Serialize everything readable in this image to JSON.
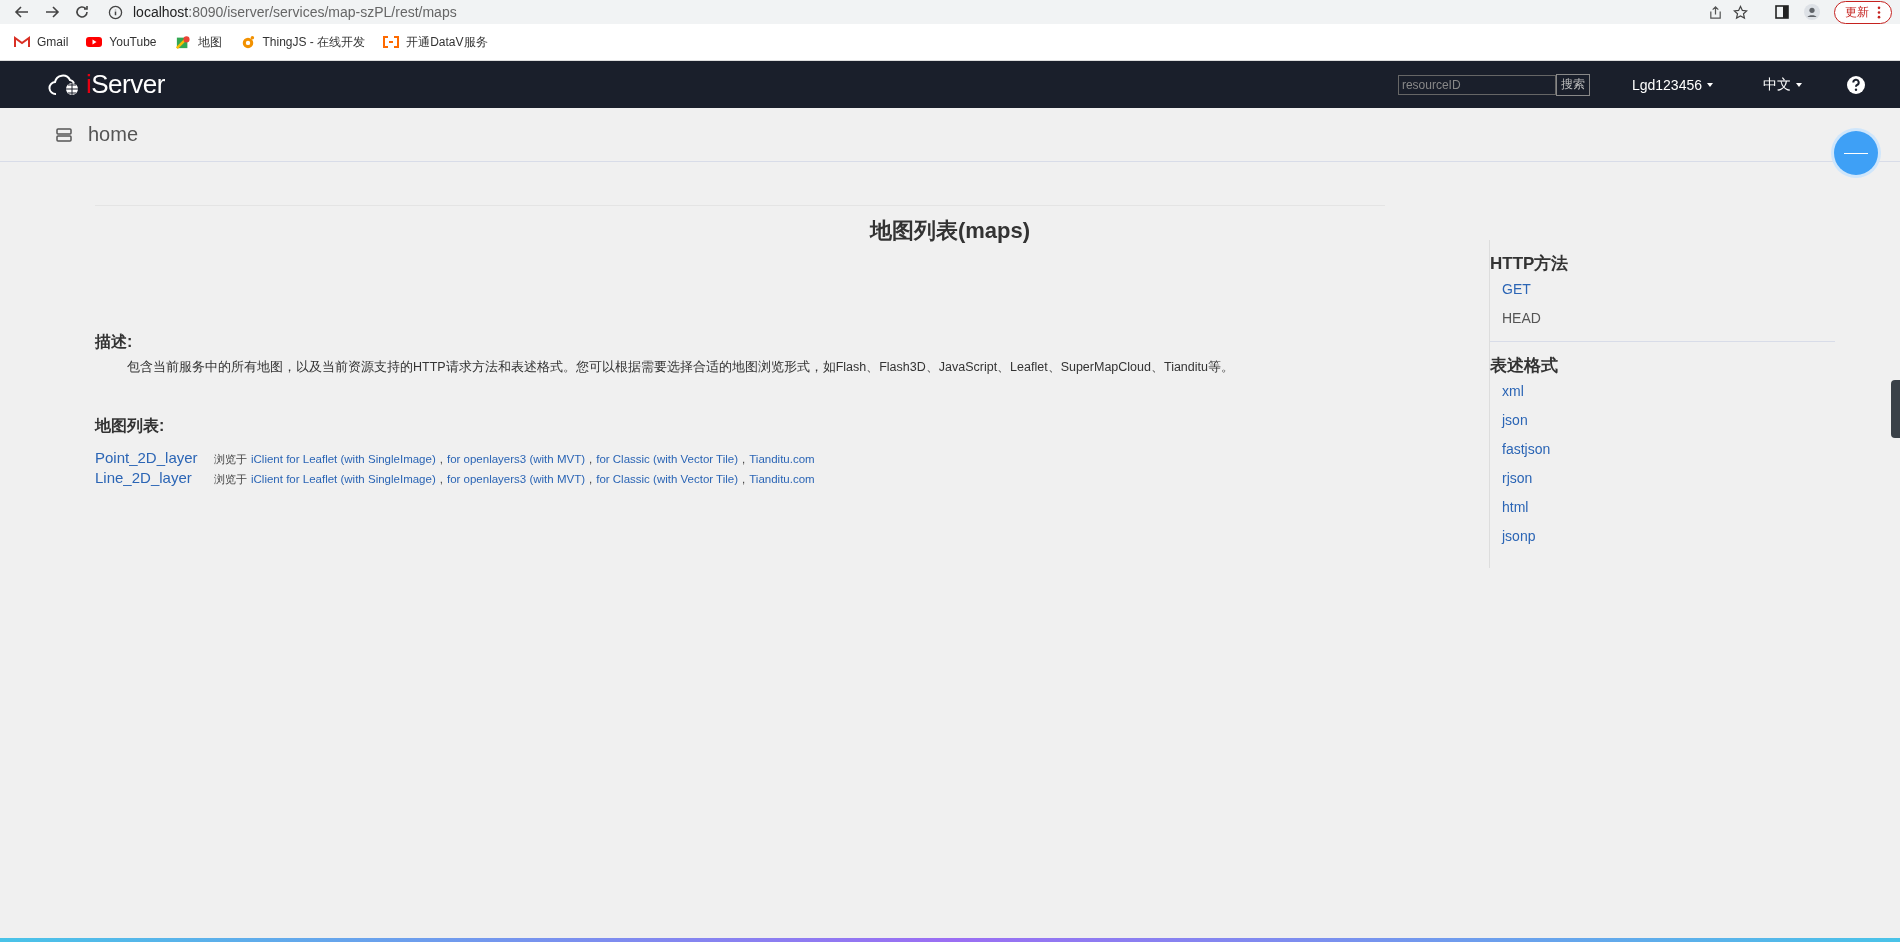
{
  "browser": {
    "url_host": "localhost",
    "url_rest": ":8090/iserver/services/map-szPL/rest/maps",
    "update_button": "更新",
    "bookmarks": [
      {
        "label": "Gmail",
        "kind": "gmail"
      },
      {
        "label": "YouTube",
        "kind": "youtube"
      },
      {
        "label": "地图",
        "kind": "maps"
      },
      {
        "label": "ThingJS - 在线开发",
        "kind": "thingjs"
      },
      {
        "label": "开通DataV服务",
        "kind": "datav"
      }
    ]
  },
  "navbar": {
    "logo_prefix": "i",
    "logo_rest": "Server",
    "search": {
      "placeholder": "resourceID",
      "button": "搜索"
    },
    "user": "Lgd123456",
    "language": "中文"
  },
  "breadcrumb": "home",
  "title": "地图列表(maps)",
  "description": {
    "heading": "描述:",
    "text": "包含当前服务中的所有地图，以及当前资源支持的HTTP请求方法和表述格式。您可以根据需要选择合适的地图浏览形式，如Flash、Flash3D、JavaScript、Leaflet、SuperMapCloud、Tianditu等。"
  },
  "map_list": {
    "heading": "地图列表:",
    "rows": [
      {
        "name": "Point_2D_layer",
        "prefix": "浏览于",
        "items": [
          {
            "kind": "link",
            "text": "iClient for Leaflet (with SingleImage)"
          },
          {
            "kind": "sep",
            "text": ","
          },
          {
            "kind": "link",
            "text": "for openlayers3 (with MVT)"
          },
          {
            "kind": "sep",
            "text": ","
          },
          {
            "kind": "link",
            "text": "for Classic (with Vector Tile)"
          },
          {
            "kind": "sep",
            "text": ","
          },
          {
            "kind": "link",
            "text": "Tianditu.com"
          }
        ]
      },
      {
        "name": "Line_2D_layer",
        "prefix": "浏览于",
        "items": [
          {
            "kind": "link",
            "text": "iClient for Leaflet (with SingleImage)"
          },
          {
            "kind": "sep",
            "text": ","
          },
          {
            "kind": "link",
            "text": "for openlayers3 (with MVT)"
          },
          {
            "kind": "sep",
            "text": ","
          },
          {
            "kind": "link",
            "text": "for Classic (with Vector Tile)"
          },
          {
            "kind": "sep",
            "text": ","
          },
          {
            "kind": "link",
            "text": "Tianditu.com"
          }
        ]
      }
    ]
  },
  "sidebar": {
    "methods_heading": "HTTP方法",
    "methods": [
      {
        "label": "GET",
        "linked": true
      },
      {
        "label": "HEAD",
        "linked": false
      }
    ],
    "formats_heading": "表述格式",
    "formats": [
      "xml",
      "json",
      "fastjson",
      "rjson",
      "html",
      "jsonp"
    ]
  }
}
